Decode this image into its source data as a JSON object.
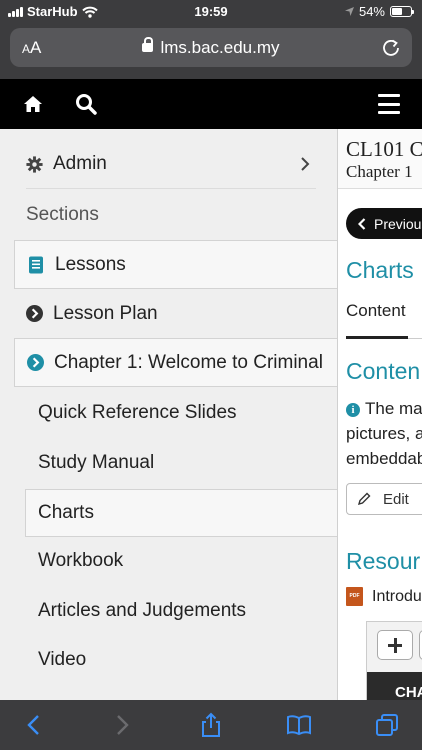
{
  "status_bar": {
    "carrier": "StarHub",
    "time": "19:59",
    "battery_percent": "54%",
    "battery_level": 0.54
  },
  "browser": {
    "text_size_label": "AA",
    "url": "lms.bac.edu.my"
  },
  "drawer": {
    "admin_label": "Admin",
    "sections_label": "Sections",
    "items": [
      {
        "label": "Lessons"
      },
      {
        "label": "Lesson Plan"
      },
      {
        "label": "Chapter 1: Welcome to Criminal"
      }
    ],
    "sub_items": [
      {
        "label": "Quick Reference Slides"
      },
      {
        "label": "Study Manual"
      },
      {
        "label": "Charts"
      },
      {
        "label": "Workbook"
      },
      {
        "label": "Articles and Judgements"
      },
      {
        "label": "Video"
      }
    ]
  },
  "content": {
    "course_title": "CL101 C",
    "course_subtitle": "Chapter 1",
    "previous_label": "Previous",
    "page_heading": "Charts",
    "tab_label": "Content",
    "content_heading": "Conten",
    "info_lines": [
      "The ma",
      "pictures, a",
      "embeddab"
    ],
    "edit_label": "Edit",
    "resources_heading": "Resour",
    "resource_item": "Introdu",
    "embed_text": "CHA"
  },
  "colors": {
    "accent": "#1f8fa6",
    "chrome_dark": "#3c3c3e",
    "header_black": "#000000",
    "ios_blue": "#3a8ef6"
  },
  "icons": {
    "home": "home-icon",
    "search": "search-icon",
    "menu": "hamburger-menu-icon",
    "admin": "gear-icon",
    "lessons": "book-icon",
    "lesson_plan": "chevron-circle-icon",
    "chapter": "chevron-circle-icon"
  }
}
